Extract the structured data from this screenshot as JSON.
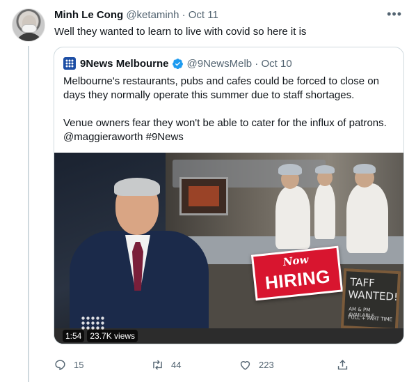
{
  "author": {
    "name": "Minh Le Cong",
    "handle": "@ketaminh",
    "separator": "·",
    "date": "Oct 11"
  },
  "tweet_text": "Well they wanted to learn to live with covid so here it is",
  "more_icon": "more-icon",
  "quoted": {
    "name": "9News Melbourne",
    "handle": "@9NewsMelb",
    "separator": "·",
    "date": "Oct 10",
    "verified_color": "#1d9bf0",
    "text_1": "Melbourne's restaurants, pubs and cafes could be forced to close on days they normally operate this summer due to staff shortages.",
    "text_2": "Venue owners fear they won't be able to cater for the influx of patrons. @maggieraworth #9News",
    "media": {
      "duration": "1:54",
      "views": "23.7K views",
      "sign_now": "Now",
      "sign_hiring": "HIRING",
      "board_line1": "TAFF",
      "board_line2": "WANTED!",
      "board_line3": "AM & PM AVAILABLE",
      "board_line4": "FULL + PART TIME"
    }
  },
  "actions": {
    "replies": "15",
    "retweets": "44",
    "likes": "223"
  },
  "colors": {
    "muted": "#536471",
    "border": "#cfd9de",
    "hiring_red": "#d8152f"
  }
}
